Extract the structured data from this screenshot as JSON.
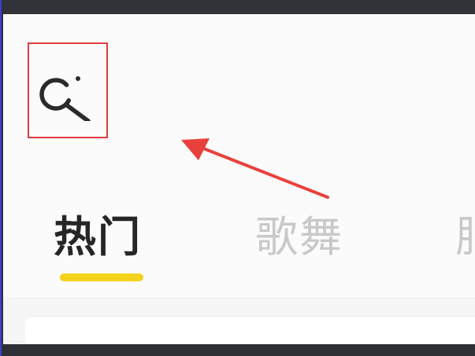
{
  "search": {
    "icon": "search-icon",
    "highlight_color": "#e23b3b"
  },
  "annotation": {
    "arrow_color": "#e8413c"
  },
  "tabs": [
    {
      "label": "热门",
      "active": true
    },
    {
      "label": "歌舞",
      "active": false
    },
    {
      "label": "肥",
      "active": false
    }
  ],
  "colors": {
    "accent": "#f5d21d",
    "active_tab": "#262626",
    "inactive_tab": "#c9c9c9"
  }
}
